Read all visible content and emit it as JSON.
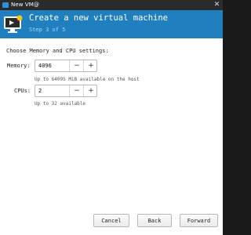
{
  "window": {
    "title": "New VM@"
  },
  "header": {
    "title": "Create a new virtual machine",
    "step": "Step 3 of 5",
    "icon": "computer-monitor-icon",
    "color": "#1f7fbf"
  },
  "content": {
    "heading": "Choose Memory and CPU settings:",
    "memory": {
      "label": "Memory:",
      "value": "4096",
      "hint": "Up to 64095 MiB available on the host"
    },
    "cpus": {
      "label": "CPUs:",
      "value": "2",
      "hint": "Up to 32 available"
    },
    "stepper": {
      "minus": "−",
      "plus": "+"
    }
  },
  "footer": {
    "cancel": "Cancel",
    "back": "Back",
    "forward": "Forward"
  }
}
